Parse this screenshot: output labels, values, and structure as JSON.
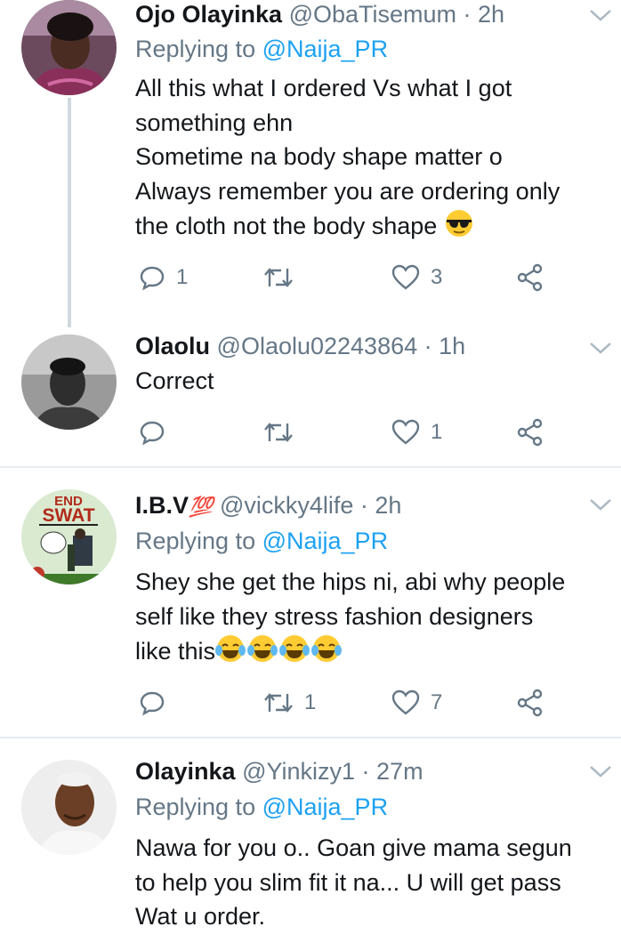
{
  "tweets": [
    {
      "name": "Ojo Olayinka",
      "handle": "@ObaTisemum",
      "time": "· 2h",
      "replying_prefix": "Replying to",
      "replying_to": "@Naija_PR",
      "lines": [
        "All this what I ordered Vs what I got",
        "something ehn",
        "Sometime na body shape matter o",
        "Always remember you are ordering only",
        "the cloth not the body shape"
      ],
      "emoji": "smiling-face-with-sunglasses",
      "reply_count": "1",
      "retweet_count": "",
      "like_count": "3"
    },
    {
      "name": "Olaolu",
      "handle": "@Olaolu02243864",
      "time": "· 1h",
      "lines": [
        "Correct"
      ],
      "reply_count": "",
      "retweet_count": "",
      "like_count": "1"
    },
    {
      "name": "I.B.V",
      "name_badge": "💯",
      "handle": "@vickky4life",
      "time": "· 2h",
      "replying_prefix": "Replying to",
      "replying_to": "@Naija_PR",
      "lines": [
        "Shey she get the hips ni, abi why people",
        "self like they stress fashion designers",
        "like this"
      ],
      "emoji": "face-with-tears-of-joy x4",
      "avatar_text_top": "END",
      "avatar_text_main": "SWAT",
      "reply_count": "",
      "retweet_count": "1",
      "like_count": "7"
    },
    {
      "name": "Olayinka",
      "handle": "@Yinkizy1",
      "time": "· 27m",
      "replying_prefix": "Replying to",
      "replying_to": "@Naija_PR",
      "lines": [
        "Nawa for you o.. Goan give mama segun",
        "to help you slim fit it na... U will get pass",
        "Wat u order."
      ]
    }
  ],
  "colors": {
    "text": "#14171a",
    "secondary": "#657786",
    "link": "#1da1f2",
    "divider": "#e6ecf0",
    "thread_line": "#cfd9de"
  },
  "icons": [
    "reply-icon",
    "retweet-icon",
    "like-icon",
    "share-icon",
    "chevron-down-icon"
  ]
}
